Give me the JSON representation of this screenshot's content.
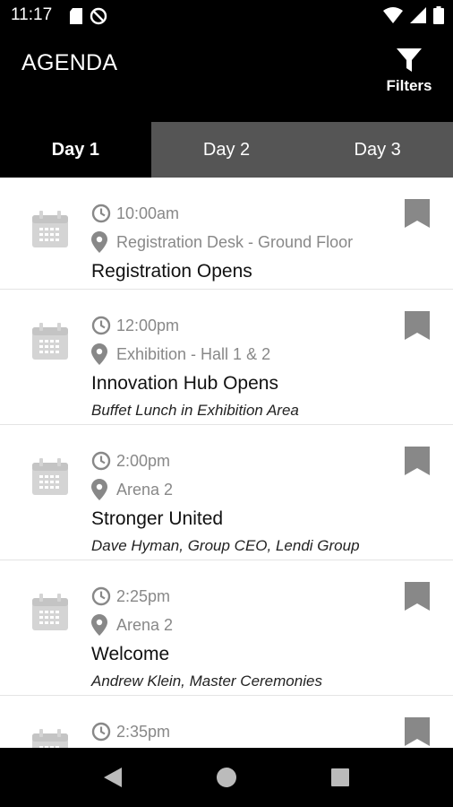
{
  "status_bar": {
    "time": "11:17"
  },
  "app_bar": {
    "title": "AGENDA",
    "filters_label": "Filters"
  },
  "tabs": [
    {
      "label": "Day 1",
      "active": true
    },
    {
      "label": "Day 2",
      "active": false
    },
    {
      "label": "Day 3",
      "active": false
    }
  ],
  "sessions": [
    {
      "time": "10:00am",
      "location": "Registration Desk - Ground Floor",
      "title": "Registration Opens",
      "subtitle": ""
    },
    {
      "time": "12:00pm",
      "location": "Exhibition - Hall 1 & 2",
      "title": "Innovation Hub Opens",
      "subtitle": "Buffet Lunch in Exhibition Area"
    },
    {
      "time": "2:00pm",
      "location": "Arena 2",
      "title": "Stronger United",
      "subtitle": "Dave Hyman, Group CEO, Lendi Group"
    },
    {
      "time": "2:25pm",
      "location": "Arena 2",
      "title": "Welcome",
      "subtitle": "Andrew Klein, Master Ceremonies"
    },
    {
      "time": "2:35pm",
      "location": "",
      "title": "",
      "subtitle": ""
    }
  ],
  "colors": {
    "primary": "#000000",
    "tab_inactive": "#555555",
    "icon_gray": "#888888",
    "calendar_gray": "#d4d4d4"
  },
  "icons": {
    "time": "clock-icon",
    "location": "map-pin-icon",
    "bookmark": "bookmark-icon",
    "event": "calendar-icon",
    "filter": "filter-icon"
  }
}
